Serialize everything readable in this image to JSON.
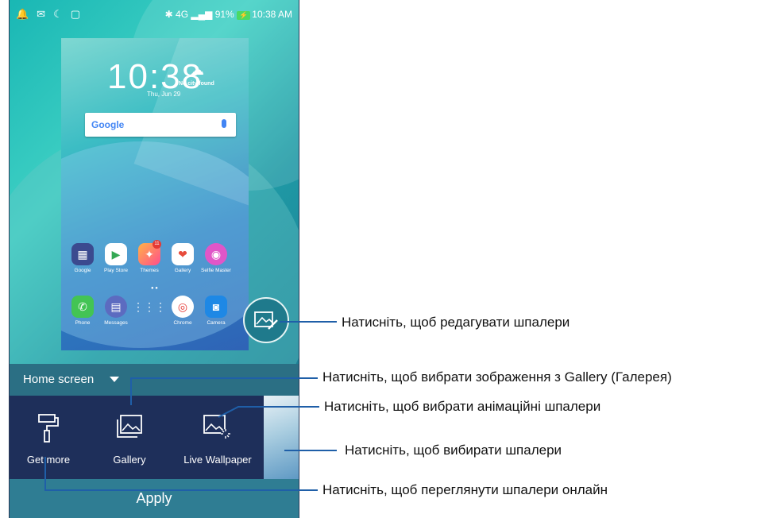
{
  "statusbar": {
    "left_icons": [
      "notification-icon",
      "mail-icon",
      "moon-icon",
      "sdcard-icon"
    ],
    "network": "4G",
    "battery": "91%",
    "time": "10:38 AM"
  },
  "preview": {
    "clock": "10:38",
    "date": "Thu, Jun 29",
    "weather": "No city found",
    "search_logo": "Google",
    "apps_row1": [
      {
        "label": "Google",
        "color": "#3b4a8f",
        "icon": "folder-icon"
      },
      {
        "label": "Play Store",
        "color": "#ffffff",
        "icon": "play-store-icon"
      },
      {
        "label": "Themes",
        "color": "#ff6f91",
        "icon": "themes-icon",
        "badge": "11"
      },
      {
        "label": "Gallery",
        "color": "#ffffff",
        "icon": "gallery-icon"
      },
      {
        "label": "Selfie Master",
        "color": "#e056c8",
        "icon": "selfie-icon"
      }
    ],
    "apps_row2": [
      {
        "label": "Phone",
        "color": "#43c454",
        "icon": "phone-icon"
      },
      {
        "label": "Messages",
        "color": "#5c6bc0",
        "icon": "messages-icon"
      },
      {
        "label": "",
        "color": "transparent",
        "icon": "app-drawer-icon"
      },
      {
        "label": "Chrome",
        "color": "#ffffff",
        "icon": "chrome-icon"
      },
      {
        "label": "Camera",
        "color": "#1e88e5",
        "icon": "camera-icon"
      }
    ]
  },
  "home_screen_selector": {
    "label": "Home screen"
  },
  "options": [
    {
      "label": "Get more",
      "icon": "paint-roller-icon"
    },
    {
      "label": "Gallery",
      "icon": "gallery-icon"
    },
    {
      "label": "Live Wallpaper",
      "icon": "live-wallpaper-icon"
    }
  ],
  "apply_button": {
    "label": "Apply"
  },
  "callouts": {
    "edit": "Натисніть, щоб редагувати шпалери",
    "gallery": "Натисніть, щоб вибрати зображення з Gallery (Галерея)",
    "live": "Натисніть, щоб вибрати анімаційні шпалери",
    "choose": "Натисніть, щоб вибирати шпалери",
    "online": "Натисніть, щоб переглянути шпалери онлайн"
  },
  "colors": {
    "panel": "#1e2f5a",
    "homebar": "#2b6f84",
    "apply": "#2f7d93",
    "callout_line": "#1f5fa8"
  }
}
